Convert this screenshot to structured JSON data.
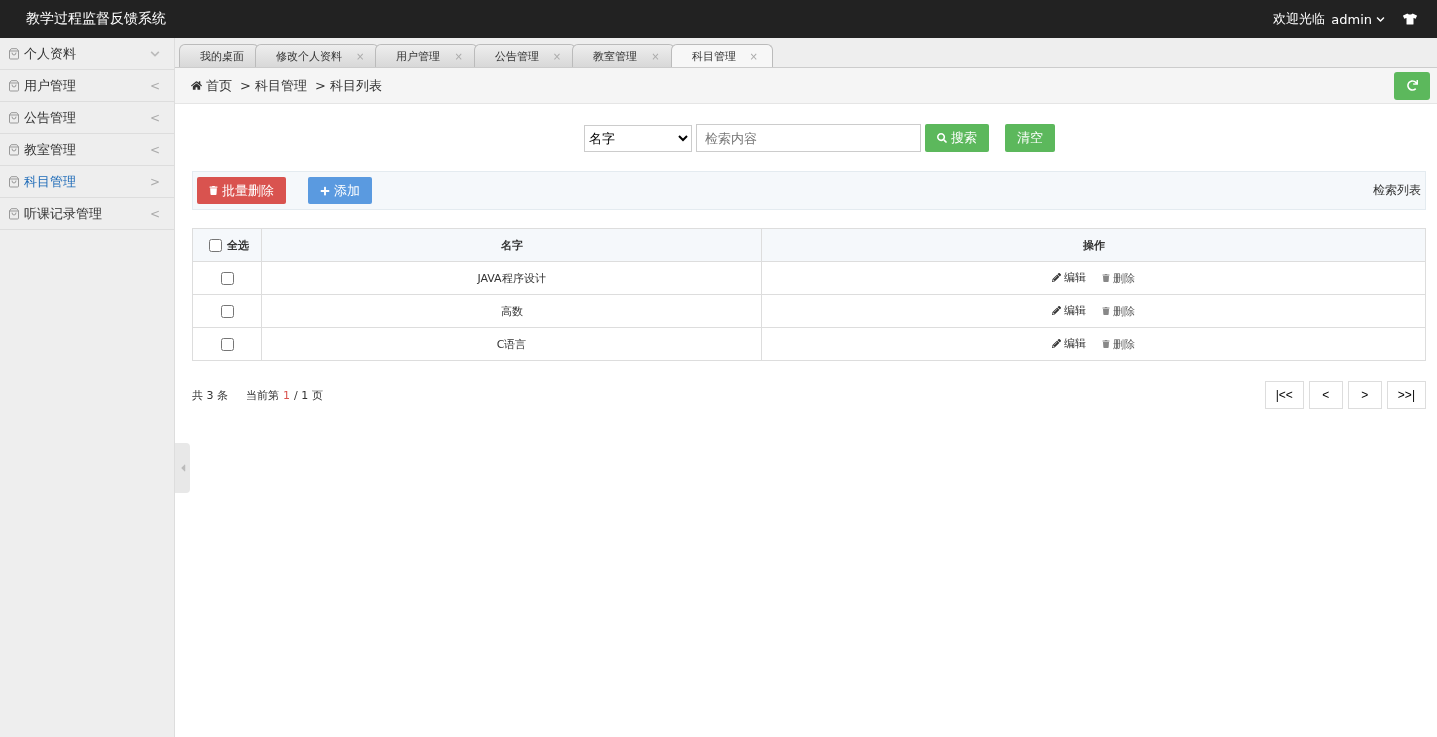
{
  "header": {
    "title": "教学过程监督反馈系统",
    "welcome": "欢迎光临",
    "user": "admin"
  },
  "sidebar": {
    "items": [
      {
        "label": "个人资料",
        "selected": false,
        "expanded": true
      },
      {
        "label": "用户管理",
        "selected": false,
        "expanded": false,
        "arrow": "<"
      },
      {
        "label": "公告管理",
        "selected": false,
        "expanded": false,
        "arrow": "<"
      },
      {
        "label": "教室管理",
        "selected": false,
        "expanded": false,
        "arrow": "<"
      },
      {
        "label": "科目管理",
        "selected": true,
        "expanded": false,
        "arrow": ">"
      },
      {
        "label": "听课记录管理",
        "selected": false,
        "expanded": false,
        "arrow": "<"
      }
    ]
  },
  "tabs": [
    {
      "label": "我的桌面",
      "selected": false
    },
    {
      "label": "修改个人资料",
      "selected": false,
      "close": "×"
    },
    {
      "label": "用户管理",
      "selected": false,
      "close": "×"
    },
    {
      "label": "公告管理",
      "selected": false,
      "close": "×"
    },
    {
      "label": "教室管理",
      "selected": false,
      "close": "×"
    },
    {
      "label": "科目管理",
      "selected": true,
      "close": "×"
    }
  ],
  "breadcrumb": [
    "首页",
    "> 科目管理",
    "> 科目列表"
  ],
  "search": {
    "field": "名字",
    "placeholder": "检索内容",
    "search_button": "搜索",
    "clear_button": "清空"
  },
  "toolbar": {
    "delete_button": "批量删除",
    "add_button": "添加",
    "caption": "检索列表"
  },
  "table": {
    "select_all": {
      "label": "全选",
      "checked": false
    },
    "columns": [
      "名字",
      "操作"
    ],
    "rows": [
      {
        "checked": false,
        "name": "JAVA程序设计",
        "actions": [
          "编辑",
          "删除"
        ]
      },
      {
        "checked": false,
        "name": "高数",
        "actions": [
          "编辑",
          "删除"
        ]
      },
      {
        "checked": false,
        "name": "C语言",
        "actions": [
          "编辑",
          "删除"
        ]
      }
    ]
  },
  "pagination": {
    "total": "共 3 条",
    "current_prefix": "当前第",
    "current": "1",
    "pages": "/ 1 页",
    "buttons": [
      "|<<",
      "<",
      ">",
      ">>|"
    ]
  }
}
